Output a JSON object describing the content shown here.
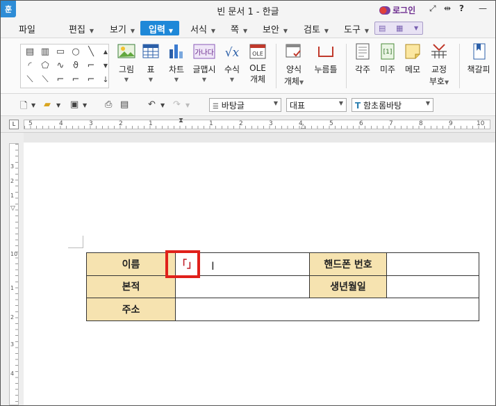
{
  "window": {
    "app_icon": "훈",
    "title": "빈 문서 1 - 한글",
    "login": "로그인"
  },
  "titlebar_icons": [
    "expand-icon",
    "split-icon",
    "help-icon",
    "minimize-icon"
  ],
  "menu": {
    "items": [
      "파일",
      "편집",
      "보기",
      "입력",
      "서식",
      "쪽",
      "보안",
      "검토",
      "도구"
    ],
    "active": "입력"
  },
  "ribbon": {
    "buttons": [
      {
        "label": "그림",
        "icon": "picture-icon"
      },
      {
        "label": "표",
        "icon": "table-icon"
      },
      {
        "label": "차트",
        "icon": "chart-icon"
      },
      {
        "label": "글맵시",
        "icon": "wordart-icon"
      },
      {
        "label": "수식",
        "icon": "equation-icon"
      },
      {
        "label": "OLE",
        "label2": "개체",
        "icon": "ole-icon",
        "badge": "OLE"
      },
      {
        "label": "양식",
        "label2": "개체",
        "icon": "form-object-icon"
      },
      {
        "label": "누름틀",
        "icon": "press-frame-icon"
      },
      {
        "label": "각주",
        "icon": "footnote-icon"
      },
      {
        "label": "미주",
        "icon": "endnote-icon",
        "badge": "[1]"
      },
      {
        "label": "메모",
        "icon": "memo-icon"
      },
      {
        "label": "교정",
        "label2": "부호",
        "icon": "proofread-icon"
      },
      {
        "label": "책갈피",
        "icon": "bookmark-icon"
      }
    ],
    "wordart_badge": "가나다",
    "equation_badge": "√x"
  },
  "format_toolbar": {
    "style": "바탕글",
    "representative": "대표",
    "font": "함초롬바탕"
  },
  "ruler": {
    "h_numbers": [
      "5",
      "4",
      "3",
      "2",
      "1",
      "1",
      "2",
      "3",
      "4",
      "5",
      "6",
      "7",
      "8",
      "9",
      "10"
    ],
    "v_numbers": [
      "3",
      "2",
      "1",
      "10",
      "1",
      "2",
      "3",
      "4"
    ]
  },
  "table": {
    "rows": [
      [
        {
          "text": "이름",
          "label": true
        },
        {
          "text": "",
          "label": false
        },
        {
          "text": "핸드폰 번호",
          "label": true
        },
        {
          "text": "",
          "label": false
        }
      ],
      [
        {
          "text": "본적",
          "label": true
        },
        {
          "text": "",
          "label": false
        },
        {
          "text": "생년월일",
          "label": true
        },
        {
          "text": "",
          "label": false
        }
      ],
      [
        {
          "text": "주소",
          "label": true
        },
        {
          "text": "",
          "label": false,
          "colspan": 3
        }
      ]
    ],
    "cell_marker": "「」"
  },
  "colors": {
    "accent": "#1e88d8",
    "label_bg": "#f6e3b0",
    "highlight": "#e0201a"
  }
}
